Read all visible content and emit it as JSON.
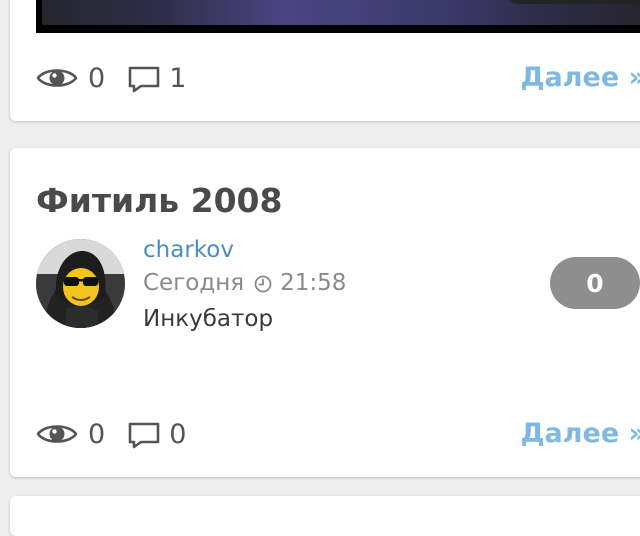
{
  "top_post": {
    "views": "0",
    "comments": "1",
    "more_label": "Далее »"
  },
  "post": {
    "title": "Фитиль 2008",
    "author": "charkov",
    "date_label": "Сегодня",
    "time": "21:58",
    "category": "Инкубатор",
    "rating": "0",
    "views": "0",
    "comments": "0",
    "more_label": "Далее »"
  },
  "icons": {
    "views": "eye-icon",
    "comments": "comment-icon",
    "time": "clock-icon"
  },
  "colors": {
    "link": "#7fb9e2",
    "author": "#4e8bc0",
    "badge": "#8e8e8e",
    "text": "#4a4a4a"
  }
}
